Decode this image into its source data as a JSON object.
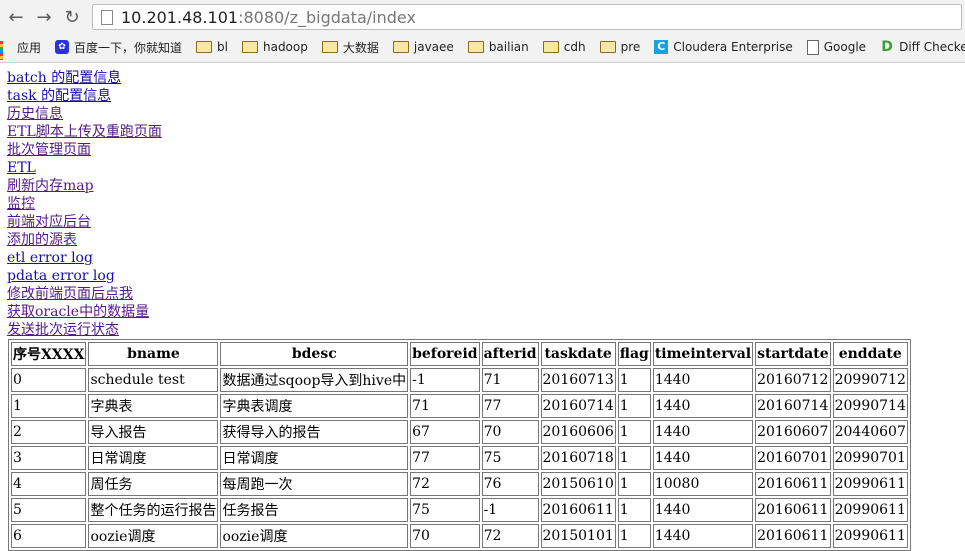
{
  "browser": {
    "url_host": "10.201.48.101",
    "url_rest": ":8080/z_bigdata/index",
    "bookmarks": [
      {
        "label": "应用",
        "icon": "apps-icon"
      },
      {
        "label": "百度一下，你就知道",
        "icon": "baidu-icon"
      },
      {
        "label": "bl",
        "icon": "folder-icon"
      },
      {
        "label": "hadoop",
        "icon": "folder-icon"
      },
      {
        "label": "大数据",
        "icon": "folder-icon"
      },
      {
        "label": "javaee",
        "icon": "folder-icon"
      },
      {
        "label": "bailian",
        "icon": "folder-icon"
      },
      {
        "label": "cdh",
        "icon": "folder-icon"
      },
      {
        "label": "pre",
        "icon": "folder-icon"
      },
      {
        "label": "Cloudera Enterprise",
        "icon": "cloudera-icon"
      },
      {
        "label": "Google",
        "icon": "page-icon"
      },
      {
        "label": "Diff Checker",
        "icon": "diffchecker-icon"
      }
    ]
  },
  "links": [
    "batch 的配置信息",
    "task 的配置信息",
    "历史信息",
    "ETL脚本上传及重跑页面",
    "批次管理页面",
    "ETL",
    "刷新内存map",
    "监控",
    "前端对应后台",
    "添加的源表",
    "etl error log",
    "pdata error log ",
    "修改前端页面后点我",
    "获取oracle中的数据量 ",
    "发送批次运行状态 "
  ],
  "table": {
    "headers": [
      "序号XXXX",
      "bname",
      "bdesc",
      "beforeid",
      "afterid",
      "taskdate",
      "flag",
      "timeinterval",
      "startdate",
      "enddate"
    ],
    "rows": [
      [
        "0",
        "schedule test",
        "数据通过sqoop导入到hive中",
        "-1",
        "71",
        "20160713",
        "1",
        "1440",
        "20160712",
        "20990712"
      ],
      [
        "1",
        "字典表",
        "字典表调度",
        "71",
        "77",
        "20160714",
        "1",
        "1440",
        "20160714",
        "20990714"
      ],
      [
        "2",
        "导入报告",
        "获得导入的报告",
        "67",
        "70",
        "20160606",
        "1",
        "1440",
        "20160607",
        "20440607"
      ],
      [
        "3",
        "日常调度",
        "日常调度",
        "77",
        "75",
        "20160718",
        "1",
        "1440",
        "20160701",
        "20990701"
      ],
      [
        "4",
        "周任务",
        "每周跑一次",
        "72",
        "76",
        "20150610",
        "1",
        "10080",
        "20160611",
        "20990611"
      ],
      [
        "5",
        "整个任务的运行报告",
        "任务报告",
        "75",
        "-1",
        "20160611",
        "1",
        "1440",
        "20160611",
        "20990611"
      ],
      [
        "6",
        "oozie调度",
        "oozie调度",
        "70",
        "72",
        "20150101",
        "1",
        "1440",
        "20160611",
        "20990611"
      ]
    ]
  }
}
